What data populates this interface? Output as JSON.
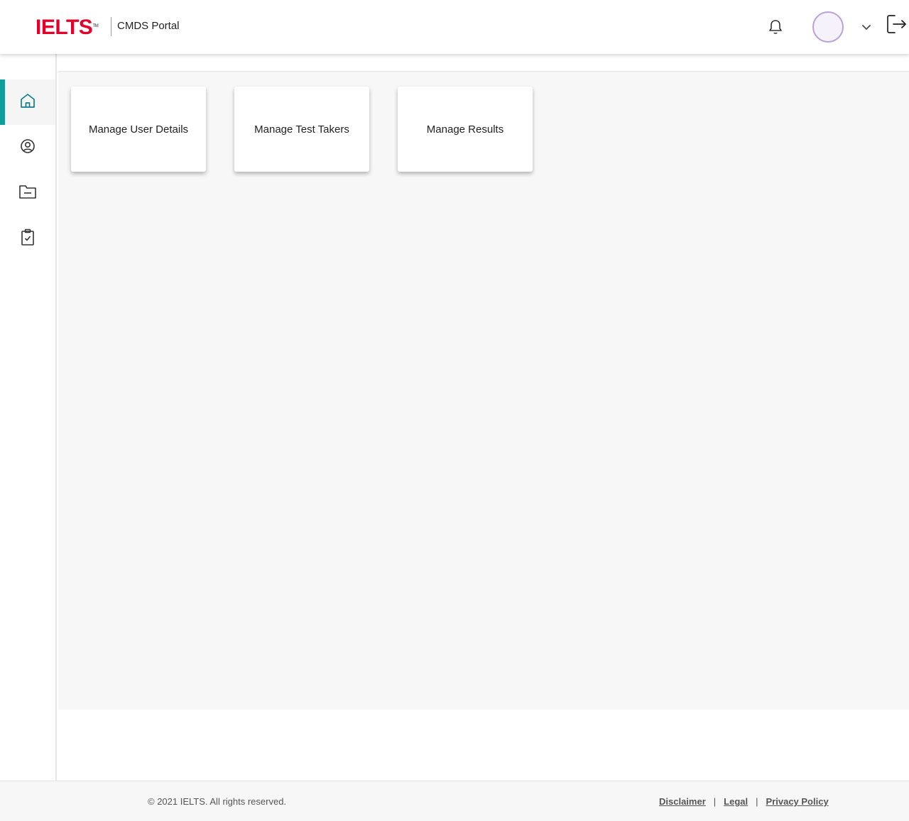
{
  "header": {
    "logo_text": "IELTS",
    "logo_tm": "TM",
    "portal_name": "CMDS Portal",
    "icons": [
      "bell-icon",
      "avatar",
      "chevron-down-icon",
      "logout-icon"
    ]
  },
  "sidebar": {
    "items": [
      {
        "name": "home",
        "icon": "home-icon",
        "active": true
      },
      {
        "name": "user",
        "icon": "user-circle-icon",
        "active": false
      },
      {
        "name": "folder",
        "icon": "folder-minus-icon",
        "active": false
      },
      {
        "name": "clipboard",
        "icon": "clipboard-check-icon",
        "active": false
      }
    ]
  },
  "main": {
    "cards": [
      {
        "label": "Manage User Details"
      },
      {
        "label": "Manage Test Takers"
      },
      {
        "label": "Manage Results"
      }
    ]
  },
  "footer": {
    "copyright": "© 2021 IELTS. All rights reserved.",
    "links": [
      {
        "label": "Disclaimer"
      },
      {
        "label": "Legal"
      },
      {
        "label": "Privacy Policy"
      }
    ],
    "separator": "|"
  },
  "colors": {
    "brand_red": "#e4002b",
    "accent_teal": "#0f9d9a",
    "avatar_border": "#b9a2d8"
  }
}
